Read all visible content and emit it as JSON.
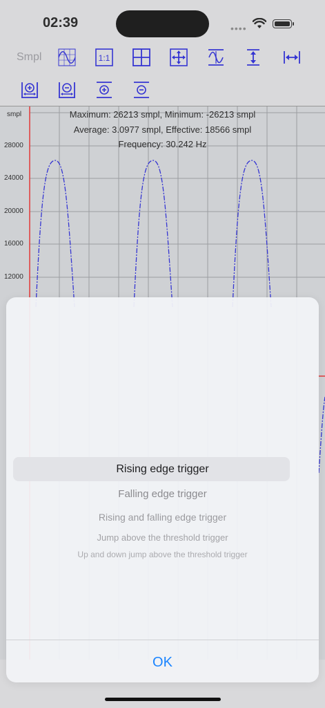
{
  "status_bar": {
    "time": "02:39"
  },
  "toolbar": {
    "label": "Smpl"
  },
  "chart": {
    "y_unit": "smpl",
    "y_ticks": [
      "28000",
      "24000",
      "20000",
      "16000",
      "12000"
    ],
    "stats": [
      "Maximum: 26213 smpl, Minimum: -26213 smpl",
      "Average: 3.0977 smpl, Effective: 18566 smpl",
      "Frequency: 30.242 Hz"
    ]
  },
  "colors": {
    "accent": "#1a84ff",
    "waveform": "#1a1acc",
    "trigger": "#e01010",
    "icon": "#1a1acc"
  },
  "picker": {
    "options": [
      "Rising edge trigger",
      "Falling edge trigger",
      "Rising and falling edge trigger",
      "Jump above the threshold trigger",
      "Up and down jump above the threshold trigger"
    ],
    "selected": "Rising edge trigger"
  },
  "dialog": {
    "ok_label": "OK"
  }
}
